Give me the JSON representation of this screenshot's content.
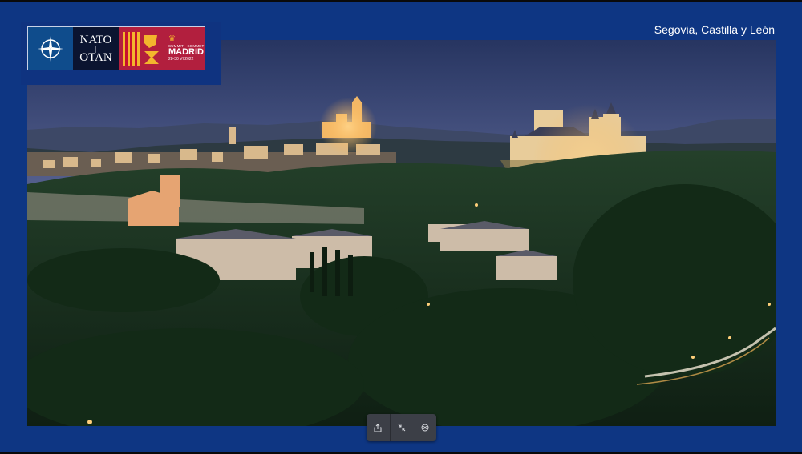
{
  "caption": "Segovia, Castilla y León",
  "logo": {
    "nato_en": "NATO",
    "nato_fr": "OTAN",
    "summit_label": "SUMMIT · SOMMET",
    "city": "MADRID",
    "dates": "28-30 VI 2022"
  },
  "photo": {
    "subject": "alcazar-of-segovia-at-dusk",
    "colors": {
      "sky_top": "#2f3e74",
      "sky_bottom": "#8c93bf",
      "mountains": "#3e4a6b",
      "forest": "#1d3520",
      "lights": "#f5b35a"
    }
  },
  "toolbar": {
    "share_icon": "share-icon",
    "collapse_icon": "collapse-icon",
    "close_icon": "close-icon"
  },
  "colors": {
    "frame": "#0f3380",
    "toolbar_bg": "#3c3f47",
    "spain_red": "#b21f3e",
    "nato_blue": "#0f4c8c"
  }
}
